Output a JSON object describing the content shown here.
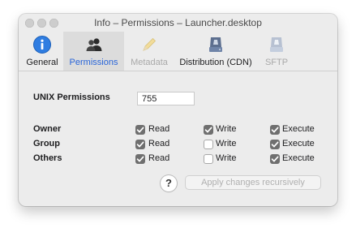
{
  "window": {
    "title": "Info – Permissions – Launcher.desktop"
  },
  "toolbar": {
    "items": [
      {
        "label": "General",
        "icon": "info-icon"
      },
      {
        "label": "Permissions",
        "icon": "users-icon",
        "selected": true
      },
      {
        "label": "Metadata",
        "icon": "pencil-icon",
        "disabled": true
      },
      {
        "label": "Distribution (CDN)",
        "icon": "drive-icon"
      },
      {
        "label": "SFTP",
        "icon": "drive-icon",
        "disabled": true
      }
    ]
  },
  "permissions": {
    "unix_label": "UNIX Permissions",
    "unix_value": "755",
    "rows": [
      {
        "label": "Owner",
        "read": true,
        "write": true,
        "execute": true
      },
      {
        "label": "Group",
        "read": true,
        "write": false,
        "execute": true
      },
      {
        "label": "Others",
        "read": true,
        "write": false,
        "execute": true
      }
    ],
    "columns": {
      "read": "Read",
      "write": "Write",
      "execute": "Execute"
    }
  },
  "footer": {
    "help_label": "?",
    "apply_label": "Apply changes recursively"
  },
  "colors": {
    "accent": "#2a66d9",
    "checkbox_on": "#6f6f6f"
  }
}
